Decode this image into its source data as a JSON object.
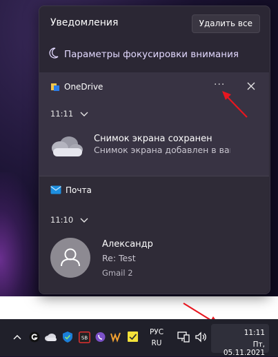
{
  "notification_center": {
    "title": "Уведомления",
    "clear_all_label": "Удалить все",
    "focus_assist_label": "Параметры фокусировки внимания"
  },
  "onedrive_group": {
    "app_name": "OneDrive",
    "more_label": "···",
    "time": "11:11",
    "notification": {
      "title": "Снимок экрана сохранен",
      "text": "Снимок экрана добавлен в ваше хра"
    }
  },
  "mail_group": {
    "app_name": "Почта",
    "time": "11:10",
    "notification": {
      "sender": "Александр",
      "subject": "Re: Test",
      "account": "Gmail 2"
    }
  },
  "taskbar": {
    "language_line1": "РУС",
    "language_line2": "RU",
    "time": "11:11",
    "date": "Пт, 05.11.2021"
  },
  "icons": [
    "moon-icon",
    "onedrive-icon",
    "more-icon",
    "close-icon",
    "chevron-down-icon",
    "cloud-icon",
    "mail-icon",
    "person-icon",
    "chevron-up-icon",
    "arrow-icon"
  ],
  "colors": {
    "annotation_arrow": "#e8161f",
    "panel_bg": "#2b2734",
    "accent_text": "#e3d9ff"
  }
}
